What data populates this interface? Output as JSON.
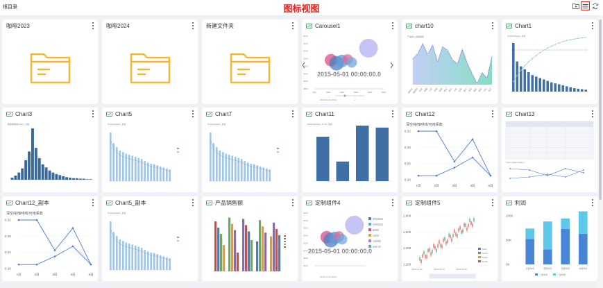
{
  "topbar": {
    "root_dir": "根目录",
    "title": "图标视图",
    "icons": [
      "folder-plus-icon",
      "list-view-icon",
      "refresh-icon"
    ]
  },
  "cards": [
    {
      "title": "咖啡2023",
      "kind": "folder"
    },
    {
      "title": "咖啡2024",
      "kind": "folder"
    },
    {
      "title": "新建文件夹",
      "kind": "folder"
    },
    {
      "title": "Carousel1",
      "kind": "chart"
    },
    {
      "title": "chart10",
      "kind": "chart"
    },
    {
      "title": "Chart1",
      "kind": "chart"
    },
    {
      "title": "Chart3",
      "kind": "chart"
    },
    {
      "title": "Chart5",
      "kind": "chart"
    },
    {
      "title": "Chart7",
      "kind": "chart"
    },
    {
      "title": "Chart11",
      "kind": "chart"
    },
    {
      "title": "Chart12",
      "kind": "chart"
    },
    {
      "title": "Chart13",
      "kind": "chart"
    },
    {
      "title": "Chart12_副本",
      "kind": "chart"
    },
    {
      "title": "Chart5_副本",
      "kind": "chart"
    },
    {
      "title": "产品销售额",
      "kind": "chart"
    },
    {
      "title": "定制组件4",
      "kind": "chart"
    },
    {
      "title": "定制组件5",
      "kind": "chart"
    },
    {
      "title": "利润",
      "kind": "chart"
    }
  ],
  "chart_data": [
    {
      "card": "Carousel1",
      "type": "scatter",
      "timeline_label": "2015-05-01 00:00:00.0",
      "x_ticks": [
        "500",
        "1000",
        "1500",
        "2000",
        "2500",
        "3000"
      ],
      "y_ticks": [
        "3150",
        "3100",
        "3050",
        "3000",
        "2950",
        "2900",
        "2850",
        "2800"
      ],
      "footer_date": "2015-01-01 00:00",
      "page_indicator": "2",
      "points": [
        {
          "x": 1100,
          "y": 2990,
          "r": 12,
          "color": "#d94f8a"
        },
        {
          "x": 1300,
          "y": 2970,
          "r": 14,
          "color": "#4a7fc1"
        },
        {
          "x": 1500,
          "y": 2985,
          "r": 12,
          "color": "#5b9bd5"
        },
        {
          "x": 1700,
          "y": 2995,
          "r": 10,
          "color": "#e0679a"
        },
        {
          "x": 1850,
          "y": 2975,
          "r": 10,
          "color": "#6fa8dc"
        },
        {
          "x": 2450,
          "y": 3070,
          "r": 18,
          "color": "#b3b0ef"
        }
      ]
    },
    {
      "card": "chart10",
      "type": "area",
      "title": "产品收入金额趋势",
      "categories": [
        "咖啡豆",
        "咖啡粉",
        "挂耳",
        "胶囊",
        "冷萃",
        "浓缩",
        "拿铁",
        "美式",
        "摩卡",
        "卡布",
        "奶茶",
        "果汁",
        "茶饮",
        "甜品",
        "面包",
        "沙拉",
        "其它"
      ],
      "values": [
        60,
        72,
        95,
        70,
        92,
        52,
        88,
        80,
        58,
        48,
        82,
        50,
        25,
        2,
        28,
        15,
        65
      ]
    },
    {
      "card": "Chart1",
      "type": "bar",
      "title": "Product/Sales_总和",
      "values": [
        100,
        62,
        52,
        46,
        40,
        34,
        31,
        28,
        25,
        22,
        19,
        17,
        15,
        13,
        11,
        9,
        7,
        6,
        5,
        4
      ]
    },
    {
      "card": "Chart3",
      "type": "bar",
      "title": "数量按季度/Sales_分组",
      "values": [
        4,
        8,
        14,
        22,
        38,
        55,
        100,
        62,
        42,
        30,
        24,
        18,
        14,
        11,
        9,
        7,
        5,
        4,
        3,
        3,
        2,
        2,
        1,
        1
      ]
    },
    {
      "card": "Chart5",
      "type": "bar",
      "title": "Product/Sales_总和",
      "values": [
        92,
        72,
        64,
        58,
        55,
        52,
        50,
        48,
        46,
        44,
        42,
        38,
        35,
        33,
        32,
        30,
        28,
        26,
        24,
        22
      ]
    },
    {
      "card": "Chart7",
      "type": "bar",
      "title": "Product/Sales_总和",
      "values": [
        92,
        72,
        64,
        58,
        55,
        52,
        50,
        48,
        46,
        44,
        42,
        38,
        35,
        33,
        32,
        30,
        28,
        26,
        24,
        22
      ]
    },
    {
      "card": "Chart11",
      "type": "bar",
      "title": "Market/Budget_Profit_总和",
      "values": [
        68,
        30,
        85,
        82
      ]
    },
    {
      "card": "Chart12",
      "type": "line",
      "title": "深空线/咖啡线/可用系数",
      "categories": [
        "1日",
        "2日",
        "3日",
        "4日",
        "5日"
      ],
      "y_ticks": [
        "8.32",
        "8.28",
        "8.24",
        "8.20"
      ],
      "series": [
        {
          "values": [
            8.32,
            8.32,
            8.245,
            8.3,
            8.21
          ]
        },
        {
          "values": [
            8.21,
            8.21,
            8.23,
            8.255,
            8.21
          ]
        }
      ]
    },
    {
      "card": "Chart13",
      "type": "table",
      "subtitle": "Policy Rate/Inflation"
    },
    {
      "card": "Chart12_副本",
      "type": "line",
      "title": "深空线/咖啡线/可用系数",
      "categories": [
        "1日",
        "2日",
        "3日",
        "4日",
        "5日"
      ],
      "y_ticks": [
        "8.32",
        "8.28",
        "8.24",
        "8.20"
      ],
      "series": [
        {
          "values": [
            8.32,
            8.32,
            8.245,
            8.3,
            8.21
          ]
        },
        {
          "values": [
            8.21,
            8.21,
            8.23,
            8.255,
            8.21
          ]
        }
      ]
    },
    {
      "card": "Chart5_副本",
      "type": "bar",
      "title": "Product/Sales_总和",
      "values": [
        92,
        72,
        64,
        58,
        55,
        52,
        50,
        48,
        46,
        44,
        42,
        38,
        35,
        33,
        32,
        30,
        28,
        26,
        24,
        22
      ]
    },
    {
      "card": "产品销售额",
      "type": "bar",
      "values": [
        80,
        62,
        86,
        50,
        84,
        70,
        48,
        82,
        56,
        78
      ]
    },
    {
      "card": "定制组件4",
      "type": "scatter",
      "timeline_label": "2015-05-01 00:00:00.0",
      "y_ticks": [
        "3150",
        "3100",
        "3050",
        "3000",
        "2950",
        "2900",
        "2850",
        "2800"
      ],
      "legend": [
        "重庆咖啡馆",
        "拿铁咖啡馆",
        "猫咖馆",
        "云集馆",
        "北极咖啡",
        "其他门店"
      ],
      "footer_date": "2015-01-01 00:00"
    },
    {
      "card": "定制组件5",
      "type": "line",
      "y_ticks": [
        "1,800",
        "1,600",
        "1,400",
        "1,200"
      ],
      "x_ticks": [
        "2003-12-02",
        "2004-02-04",
        "2004-03-26"
      ],
      "legend": [
        "MA5",
        "MA10",
        "MA20",
        "MA30"
      ]
    },
    {
      "card": "利润",
      "type": "bar",
      "y_ticks": [
        "100K",
        "50K",
        "0K"
      ],
      "categories": [
        "东部市场",
        "南部市场",
        "西部市场",
        "中部市场"
      ],
      "series": [
        {
          "name": "二级市场",
          "values": [
            68,
            40,
            95,
            82
          ]
        },
        {
          "name": "一级市场",
          "values": [
            28,
            75,
            28,
            60
          ]
        }
      ],
      "legend": [
        "二级市场",
        "一级市场"
      ]
    }
  ],
  "colors": {
    "folder": "#f3b732",
    "accent_red": "#e0231b",
    "bar_blue": "#3f6fa5",
    "light_blue": "#9fc5e8",
    "chart_icon": "#3bb36a"
  }
}
